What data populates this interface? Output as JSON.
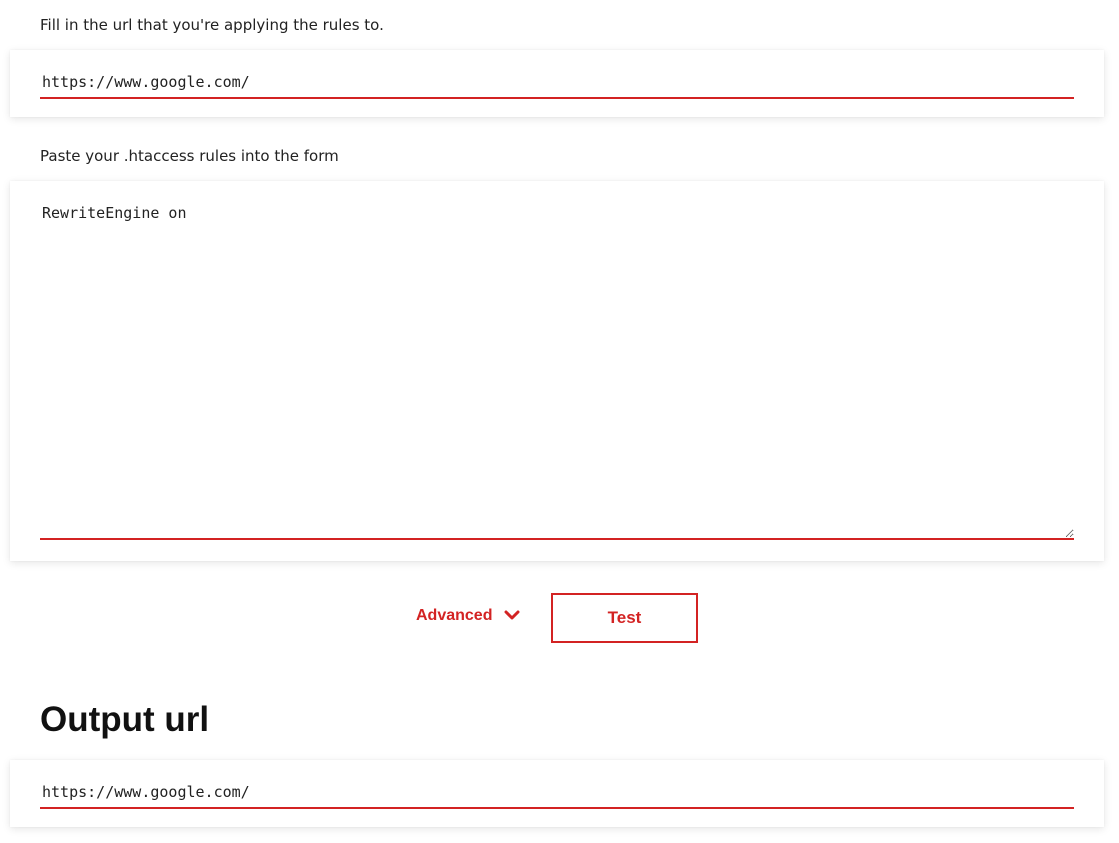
{
  "url_section": {
    "label": "Fill in the url that you're applying the rules to.",
    "value": "https://www.google.com/"
  },
  "rules_section": {
    "label": "Paste your .htaccess rules into the form",
    "value": "RewriteEngine on"
  },
  "actions": {
    "advanced_label": "Advanced",
    "test_label": "Test"
  },
  "output": {
    "heading": "Output url",
    "value": "https://www.google.com/"
  },
  "colors": {
    "accent": "#d32323"
  }
}
